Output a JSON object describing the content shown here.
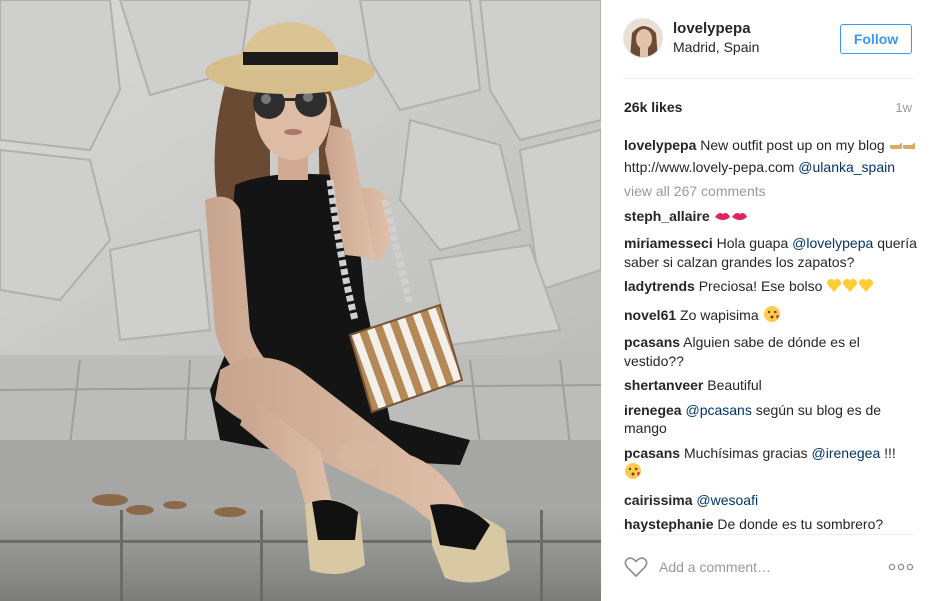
{
  "post": {
    "username": "lovelypepa",
    "location": "Madrid, Spain",
    "follow_label": "Follow",
    "likes": "26k likes",
    "time": "1w",
    "caption": {
      "user": "lovelypepa",
      "text": "New outfit post up on my blog",
      "link": "http://www.lovely-pepa.com",
      "mention": "@ulanka_spain"
    },
    "view_all": "view all 267 comments",
    "comments": [
      {
        "user": "steph_allaire",
        "pre": "",
        "mention": "",
        "post": "",
        "emoji": "lips-icon"
      },
      {
        "user": "miriamesseci",
        "pre": "Hola guapa",
        "mention": "@lovelypepa",
        "post": "quería saber si calzan grandes los zapatos?",
        "emoji": ""
      },
      {
        "user": "ladytrends",
        "pre": "Preciosa! Ese bolso",
        "mention": "",
        "post": "",
        "emoji": "yellow-hearts-icon"
      },
      {
        "user": "novel61",
        "pre": "Zo wapisima",
        "mention": "",
        "post": "",
        "emoji": "kiss-face-icon"
      },
      {
        "user": "pcasans",
        "pre": "Alguien sabe de dónde es el vestido??",
        "mention": "",
        "post": "",
        "emoji": ""
      },
      {
        "user": "shertanveer",
        "pre": "Beautiful",
        "mention": "",
        "post": "",
        "emoji": ""
      },
      {
        "user": "irenegea",
        "pre": "",
        "mention": "@pcasans",
        "post": "según su blog es de mango",
        "emoji": ""
      },
      {
        "user": "pcasans",
        "pre": "Muchísimas gracias",
        "mention": "@irenegea",
        "post": "!!!",
        "emoji": "kiss-face-icon"
      },
      {
        "user": "cairissima",
        "pre": "",
        "mention": "@wesoafi",
        "post": "",
        "emoji": ""
      },
      {
        "user": "haystephanie",
        "pre": "De donde es tu sombrero?",
        "mention": "",
        "post": "",
        "emoji": ""
      }
    ],
    "add_comment_placeholder": "Add a comment…"
  },
  "colors": {
    "accent": "#3897f0",
    "mention": "#003569",
    "muted": "#999999",
    "text": "#262626"
  },
  "icons": [
    "heart-outline-icon",
    "more-options-icon",
    "pointing-hands-icon"
  ]
}
